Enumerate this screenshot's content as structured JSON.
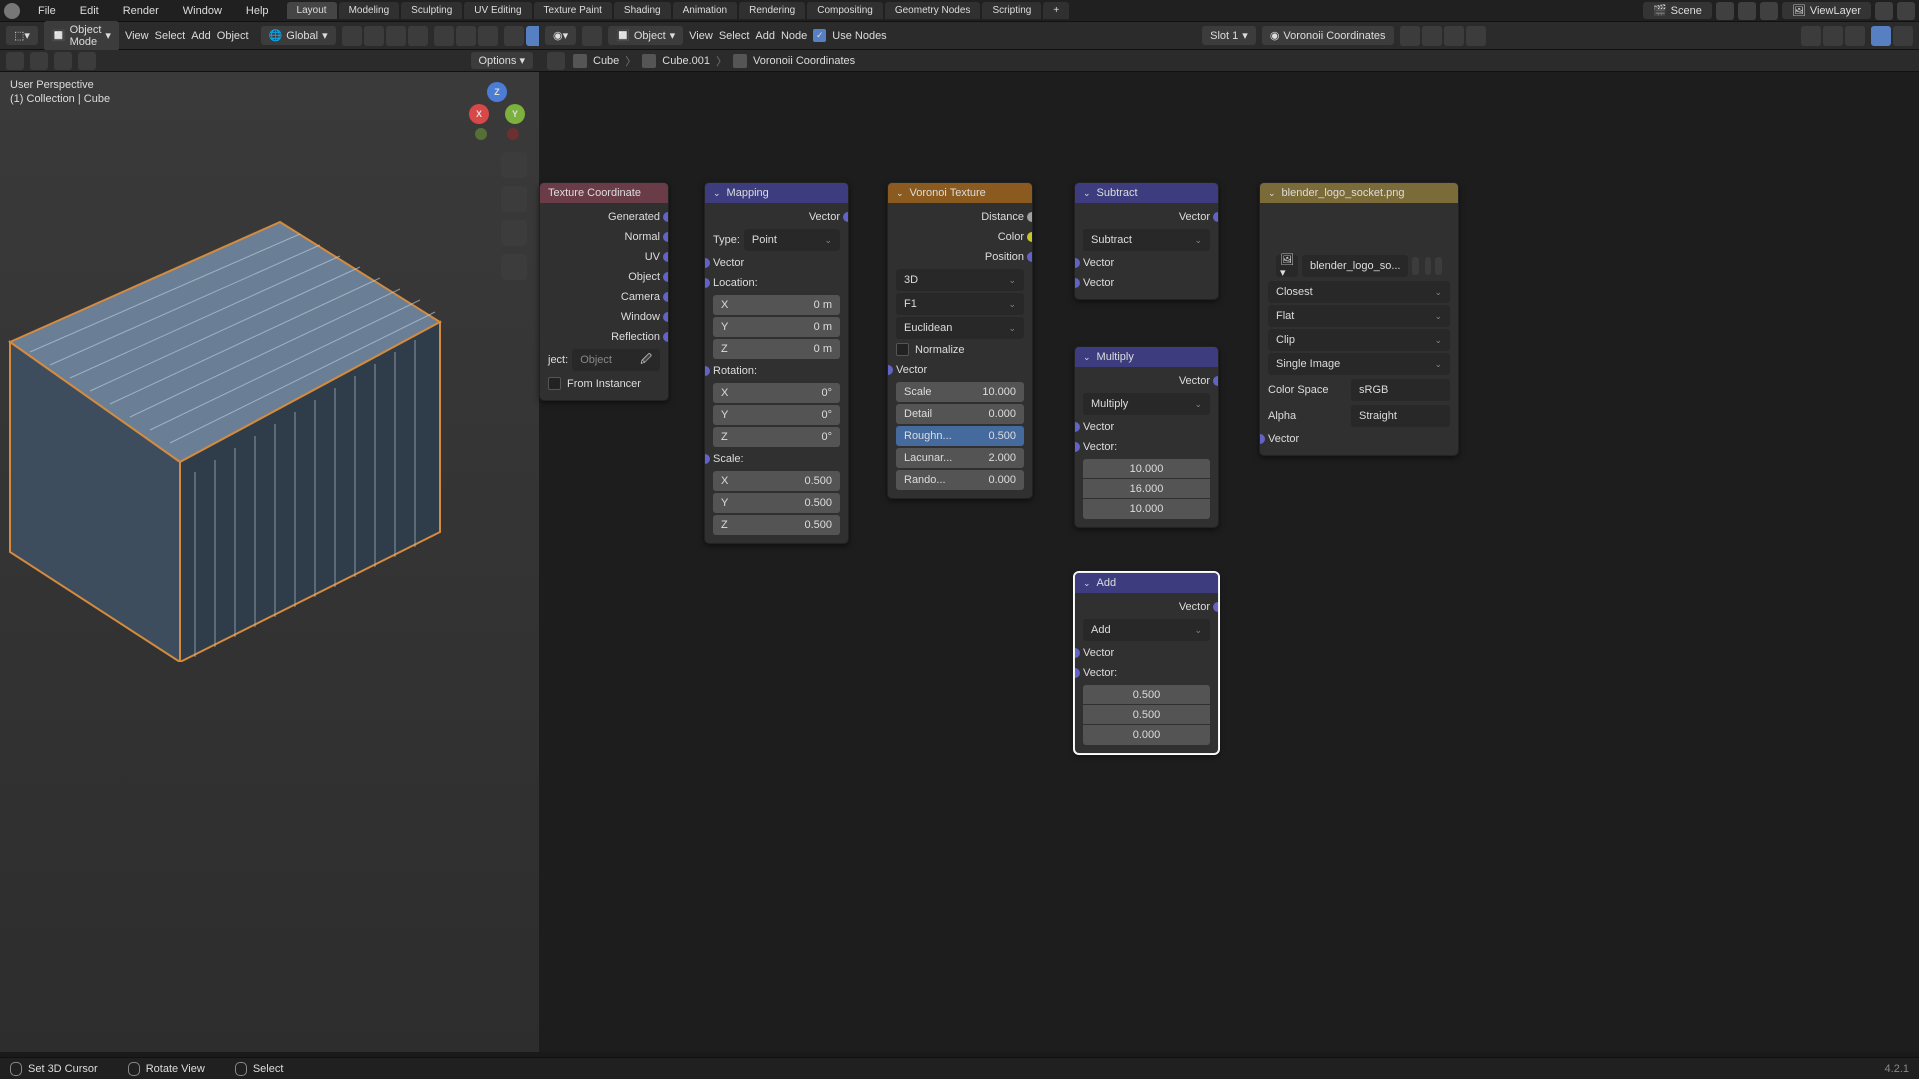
{
  "menu": {
    "items": [
      "File",
      "Edit",
      "Render",
      "Window",
      "Help"
    ],
    "tabs": [
      "Layout",
      "Modeling",
      "Sculpting",
      "UV Editing",
      "Texture Paint",
      "Shading",
      "Animation",
      "Rendering",
      "Compositing",
      "Geometry Nodes",
      "Scripting"
    ],
    "active_tab": "Layout",
    "scene": "Scene",
    "viewlayer": "ViewLayer"
  },
  "toolbar_left": {
    "mode": "Object Mode",
    "menus": [
      "View",
      "Select",
      "Add",
      "Object"
    ],
    "orient": "Global"
  },
  "toolbar_right": {
    "menus": [
      "View",
      "Select",
      "Add",
      "Node"
    ],
    "use_nodes": "Use Nodes",
    "slot": "Slot 1",
    "material": "Voronoii Coordinates",
    "object": "Object"
  },
  "row3": {
    "options": "Options"
  },
  "breadcrumb": [
    "Cube",
    "Cube.001",
    "Voronoii Coordinates"
  ],
  "viewport": {
    "line1": "User Perspective",
    "line2": "(1) Collection | Cube",
    "object_field": "Object"
  },
  "statusbar": {
    "a": "Set 3D Cursor",
    "b": "Rotate View",
    "c": "Select",
    "version": "4.2.1"
  },
  "tex_coord": {
    "title": "Texture Coordinate",
    "outs": [
      "Generated",
      "Normal",
      "UV",
      "Object",
      "Camera",
      "Window",
      "Reflection"
    ],
    "object_label": "ject:",
    "object_val": "Object",
    "instancer": "From Instancer"
  },
  "mapping": {
    "title": "Mapping",
    "out": "Vector",
    "type_lab": "Type:",
    "type": "Point",
    "in": "Vector",
    "loc_lab": "Location:",
    "loc": [
      [
        "X",
        "0 m"
      ],
      [
        "Y",
        "0 m"
      ],
      [
        "Z",
        "0 m"
      ]
    ],
    "rot_lab": "Rotation:",
    "rot": [
      [
        "X",
        "0°"
      ],
      [
        "Y",
        "0°"
      ],
      [
        "Z",
        "0°"
      ]
    ],
    "scale_lab": "Scale:",
    "scale": [
      [
        "X",
        "0.500"
      ],
      [
        "Y",
        "0.500"
      ],
      [
        "Z",
        "0.500"
      ]
    ]
  },
  "voronoi": {
    "title": "Voronoi Texture",
    "outs": [
      [
        "Distance",
        "flt"
      ],
      [
        "Color",
        "col"
      ],
      [
        "Position",
        "vec"
      ]
    ],
    "dd": [
      "3D",
      "F1",
      "Euclidean"
    ],
    "normalize": "Normalize",
    "vector": "Vector",
    "params": [
      [
        "Scale",
        "10.000"
      ],
      [
        "Detail",
        "0.000"
      ],
      [
        "Roughn...",
        "0.500"
      ],
      [
        "Lacunar...",
        "2.000"
      ],
      [
        "Rando...",
        "0.000"
      ]
    ],
    "hl_index": 2
  },
  "subtract": {
    "title": "Subtract",
    "out": "Vector",
    "op": "Subtract",
    "ins": [
      "Vector",
      "Vector"
    ]
  },
  "multiply": {
    "title": "Multiply",
    "out": "Vector",
    "op": "Multiply",
    "in": "Vector",
    "vec_lab": "Vector:",
    "vec": [
      "10.000",
      "16.000",
      "10.000"
    ]
  },
  "add": {
    "title": "Add",
    "out": "Vector",
    "op": "Add",
    "in": "Vector",
    "vec_lab": "Vector:",
    "vec": [
      "0.500",
      "0.500",
      "0.000"
    ]
  },
  "image": {
    "title": "blender_logo_socket.png",
    "img": "blender_logo_so...",
    "dd": [
      "Closest",
      "Flat",
      "Clip",
      "Single Image"
    ],
    "cs_lab": "Color Space",
    "cs": "sRGB",
    "alpha_lab": "Alpha",
    "alpha": "Straight",
    "vector": "Vector"
  }
}
